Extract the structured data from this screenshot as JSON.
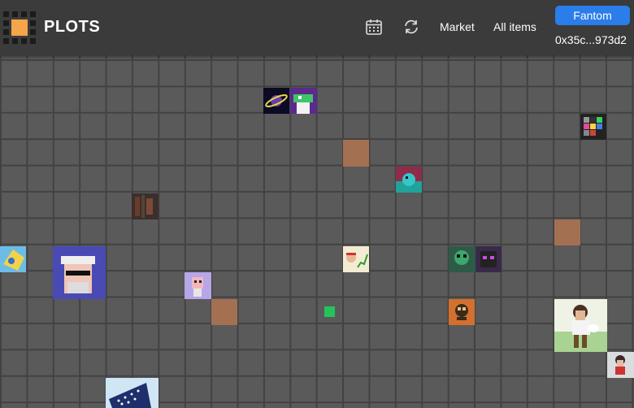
{
  "header": {
    "title": "PLOTS",
    "nav_market": "Market",
    "nav_all_items": "All items",
    "network_label": "Fantom",
    "address": "0x35c...973d2"
  },
  "icons": {
    "calendar": "calendar-icon",
    "refresh": "refresh-icon"
  },
  "colors": {
    "header_bg": "#3b3b3b",
    "grid_bg": "#5a5a5a",
    "grid_line": "#424242",
    "accent": "#2b7de9",
    "logo": "#f5a54a"
  }
}
